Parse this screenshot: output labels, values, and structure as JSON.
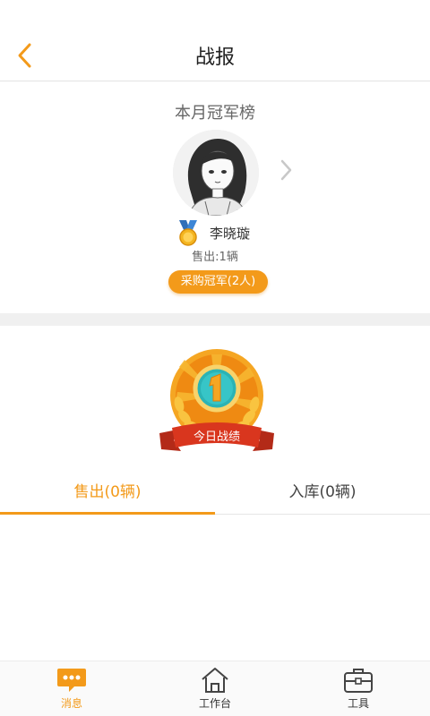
{
  "header": {
    "title": "战报",
    "back_icon": "chevron-left-icon",
    "accent": "#f39a1a"
  },
  "champion": {
    "section_title": "本月冠军榜",
    "name": "李晓璇",
    "sold": "售出:1辆",
    "buy_badge": "采购冠军(2人)",
    "avatar_icon": "avatar",
    "medal_icon": "gold-medal-icon",
    "next_icon": "chevron-right-icon"
  },
  "today": {
    "emblem_label": "今日战绩",
    "emblem_number": "1"
  },
  "tabs": [
    {
      "label": "售出(0辆)",
      "active": true
    },
    {
      "label": "入库(0辆)",
      "active": false
    }
  ],
  "tabbar": [
    {
      "label": "消息",
      "icon": "message-icon",
      "active": true
    },
    {
      "label": "工作台",
      "icon": "home-icon",
      "active": false
    },
    {
      "label": "工具",
      "icon": "toolbox-icon",
      "active": false
    }
  ]
}
